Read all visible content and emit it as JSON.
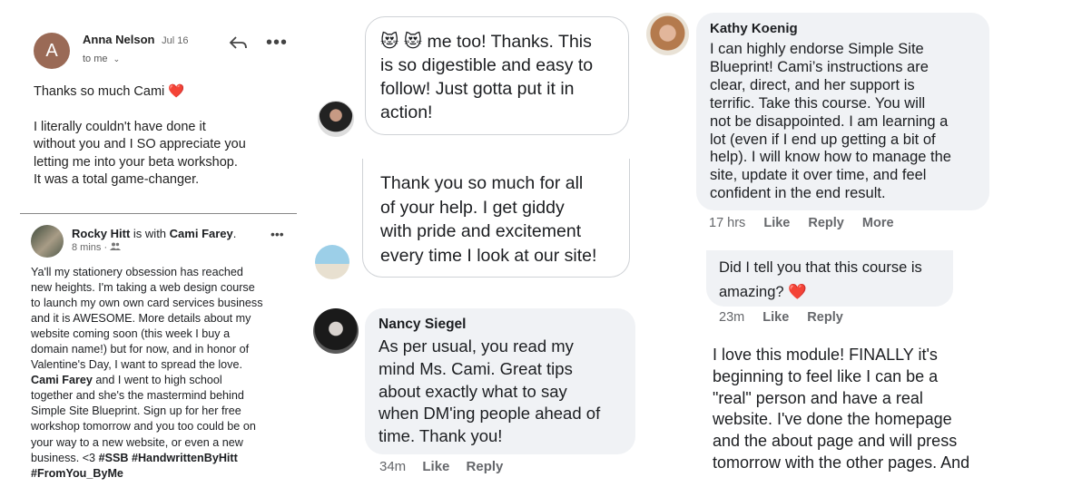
{
  "email": {
    "avatar_letter": "A",
    "sender": "Anna Nelson",
    "date": "Jul 16",
    "to": "to me",
    "line1": "Thanks so much Cami",
    "heart": "❤️",
    "body_lines": [
      "I literally couldn't have done it",
      "without you and I SO appreciate you",
      "letting me into your beta workshop.",
      "It was a total game-changer."
    ]
  },
  "post": {
    "author": "Rocky Hitt",
    "is_with": "is with",
    "tagged": "Cami Farey",
    "period": ".",
    "time": "8 mins",
    "lines": [
      "Ya'll my stationery obsession has reached",
      "new heights. I'm taking a web design course",
      "to launch my own own card services business",
      "and it is AWESOME. More details about my",
      "website coming soon (this week I buy a",
      "domain name!) but for now, and in honor of",
      "Valentine's Day, I want to spread the love."
    ],
    "mention": "Cami Farey",
    "lines2_first": " and I went to high school",
    "lines2": [
      "together and she's the mastermind behind",
      "Simple Site Blueprint. Sign up for her free",
      "workshop tomorrow and you too could be on",
      "your way to a new website, or even a new"
    ],
    "last_line_prefix": "business. <3 ",
    "hashtags1": "#SSB #HandwrittenByHitt",
    "hashtags2": "#FromYou_ByMe"
  },
  "msg1": {
    "emoji": "😻 😻",
    "lines": [
      "me too! Thanks. This",
      "is so digestible and easy to",
      "follow! Just gotta put it in",
      "action!"
    ]
  },
  "msg2": {
    "lines": [
      "Thank you so much for all",
      "of your help. I get giddy",
      "with pride and excitement",
      "every time I look at our site!"
    ]
  },
  "nancy": {
    "name": "Nancy Siegel",
    "lines": [
      "As per usual, you read my",
      "mind Ms. Cami. Great tips",
      "about exactly what to say",
      "when DM'ing people ahead of",
      "time. Thank you!"
    ],
    "time": "34m",
    "like": "Like",
    "reply": "Reply"
  },
  "kathy": {
    "name": "Kathy Koenig",
    "lines": [
      "I can highly endorse Simple Site",
      "Blueprint! Cami’s instructions are",
      "clear, direct, and her support is",
      "terrific. Take this course. You will",
      "not be disappointed. I am learning a",
      "lot (even if I end up getting a bit of",
      "help). I will know how to manage the",
      "site, update it over time, and feel",
      "confident in the end result."
    ],
    "time": "17 hrs",
    "like": "Like",
    "reply": "Reply",
    "more": "More"
  },
  "comment2": {
    "line1": "Did I tell you that this course is",
    "line2": "amazing?",
    "heart": "❤️",
    "time": "23m",
    "like": "Like",
    "reply": "Reply"
  },
  "module": {
    "lines": [
      "I love this module! FINALLY it's",
      "beginning to feel like I can be a",
      "\"real\" person and have a real",
      "website. I've done the homepage",
      "and the about page and will press",
      "tomorrow with the other pages. And"
    ]
  }
}
